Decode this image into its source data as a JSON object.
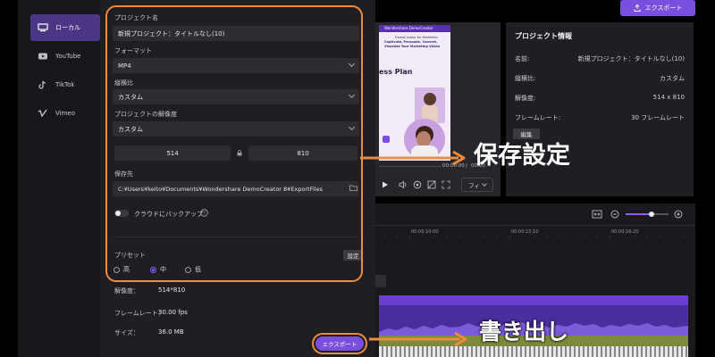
{
  "left_nav": {
    "items": [
      {
        "label": "ローカル",
        "icon": "monitor-icon",
        "active": true
      },
      {
        "label": "YouTube",
        "icon": "youtube-icon",
        "active": false
      },
      {
        "label": "TikTok",
        "icon": "tiktok-icon",
        "active": false
      },
      {
        "label": "Vimeo",
        "icon": "vimeo-icon",
        "active": false
      }
    ]
  },
  "dialog": {
    "project_name_label": "プロジェクト名",
    "project_name_value": "新規プロジェクト：タイトルなし(10)",
    "format_label": "フォーマット",
    "format_value": "MP4",
    "aspect_label": "縦横比",
    "aspect_value": "カスタム",
    "resolution_label": "プロジェクトの解像度",
    "resolution_value": "カスタム",
    "width_value": "514",
    "height_value": "810",
    "save_to_label": "保存先",
    "save_to_value": "C:¥Users¥keito¥Documents¥Wondershare DemoCreator 8¥ExportFiles",
    "cloud_backup_label": "クラウドにバックアップ",
    "preset_label": "プリセット",
    "preset_settings_label": "設定",
    "preset_options": [
      "高",
      "中",
      "低"
    ],
    "preset_selected": "中",
    "summary": [
      {
        "label": "解像度：",
        "value": "514*810"
      },
      {
        "label": "フレームレート：",
        "value": "30.00 fps"
      },
      {
        "label": "サイズ：",
        "value": "36.0 MB"
      }
    ],
    "export_button_label": "エクスポート"
  },
  "top": {
    "export_label": "エクスポート"
  },
  "preview": {
    "brand_text": "Wondershare DemoCreator",
    "promo_text": "DemoCreator for Marketers",
    "headline": "Captivate, Persuade, Convert, Visualize Your Marketing Vision",
    "plan_text": "ess Plan",
    "time_current": "00:00:00",
    "time_sep": "|",
    "time_total": "00:00",
    "fit_label": "フィ"
  },
  "info": {
    "title": "プロジェクト情報",
    "rows": [
      {
        "label": "名前:",
        "value": "新規プロジェクト：タイトルなし(10)"
      },
      {
        "label": "縦横比:",
        "value": "カスタム"
      },
      {
        "label": "解像度:",
        "value": "514 x 810"
      },
      {
        "label": "フレームレート:",
        "value": "30 フレームレート"
      }
    ],
    "edit_label": "編集"
  },
  "timeline": {
    "ticks": [
      "00:00:10:00",
      "00:00:15:10",
      "00:00:16:20"
    ],
    "zoom_level": 0.6
  },
  "annotations": {
    "save_settings": "保存設定",
    "export": "書き出し"
  },
  "colors": {
    "accent": "#7a4fe0",
    "highlight": "#f08a3c",
    "timeline_purple": "#6a3fd6",
    "timeline_olive": "#7c8a3c"
  }
}
